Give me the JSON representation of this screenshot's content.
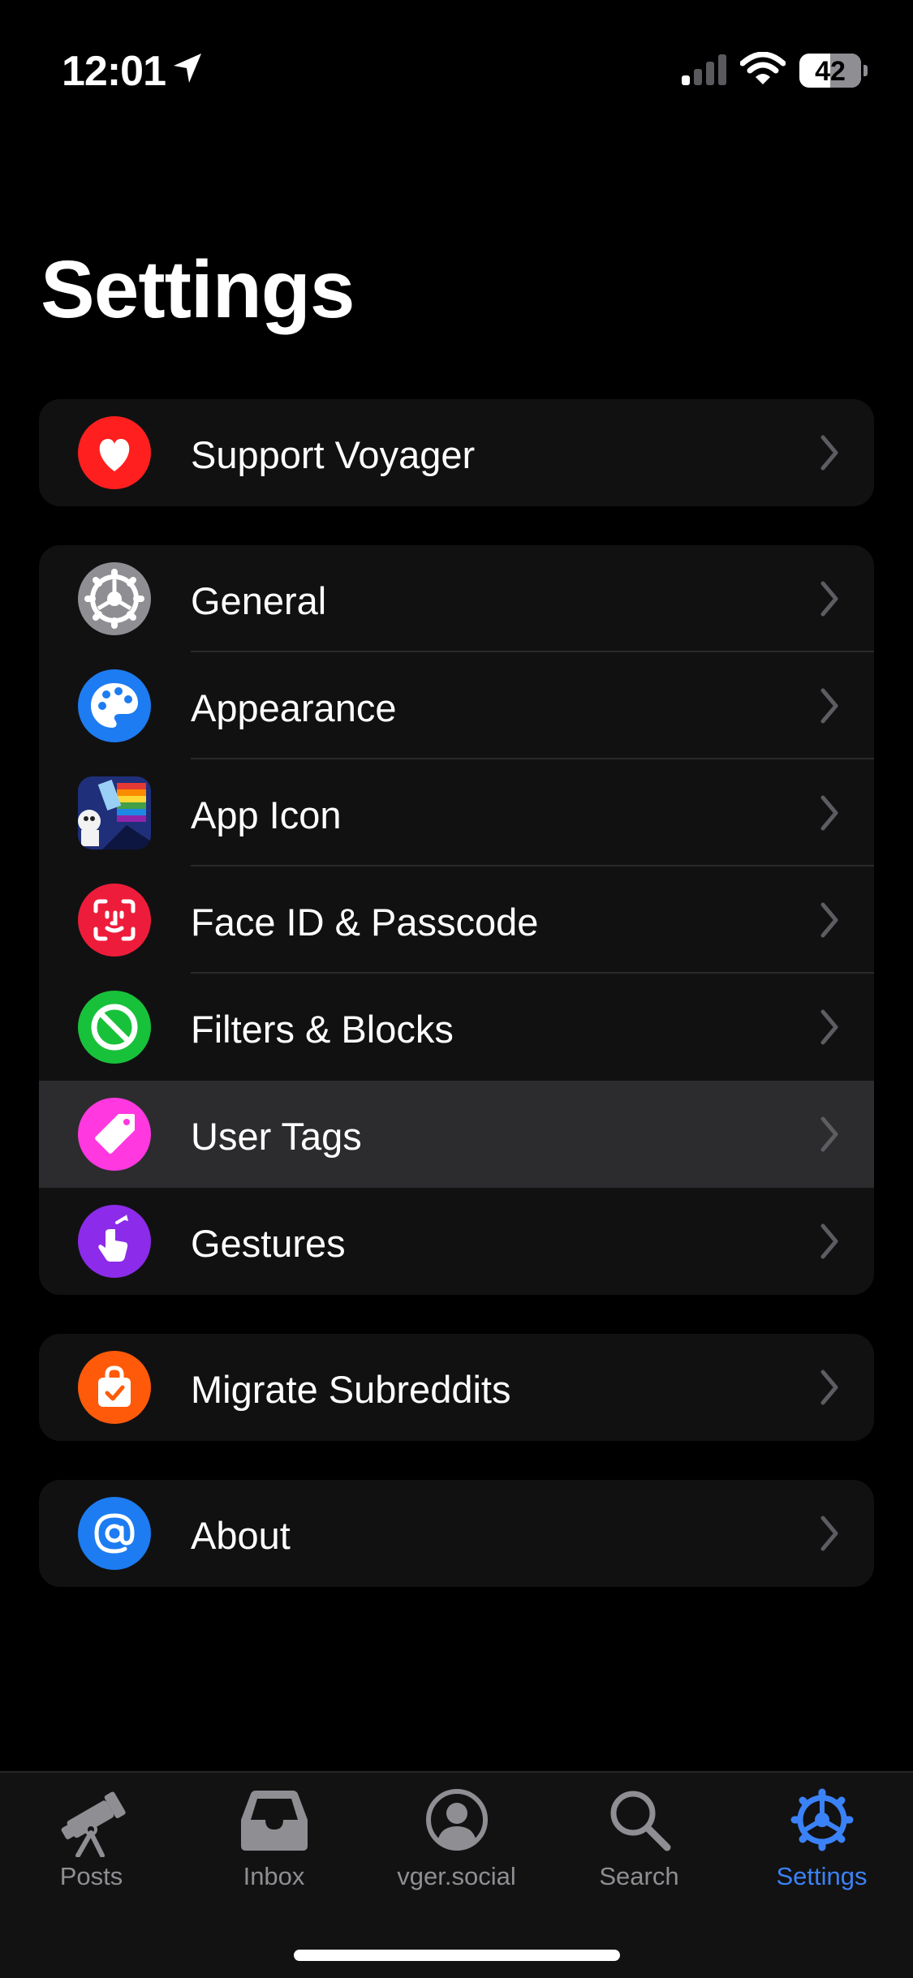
{
  "status_bar": {
    "time": "12:01",
    "battery": "42"
  },
  "page": {
    "title": "Settings"
  },
  "groups": [
    {
      "items": [
        {
          "label": "Support Voyager",
          "icon": "heart-icon",
          "color": "#ff1f1f"
        }
      ]
    },
    {
      "items": [
        {
          "label": "General",
          "icon": "gear-icon",
          "color": "#8e8e93"
        },
        {
          "label": "Appearance",
          "icon": "palette-icon",
          "color": "#1d7cf2"
        },
        {
          "label": "App Icon",
          "icon": "app-icon-image"
        },
        {
          "label": "Face ID & Passcode",
          "icon": "face-id-icon",
          "color": "#ee1c3b"
        },
        {
          "label": "Filters & Blocks",
          "icon": "block-icon",
          "color": "#18c13a"
        },
        {
          "label": "User Tags",
          "icon": "tag-icon",
          "color": "#ff38e0"
        },
        {
          "label": "Gestures",
          "icon": "hand-tap-icon",
          "color": "#8c2bea"
        }
      ]
    },
    {
      "items": [
        {
          "label": "Migrate Subreddits",
          "icon": "shopping-bag-icon",
          "color": "#ff5a0a"
        }
      ]
    },
    {
      "items": [
        {
          "label": "About",
          "icon": "at-sign-icon",
          "color": "#1d7cf2"
        }
      ]
    }
  ],
  "tab_bar": {
    "tabs": [
      {
        "label": "Posts",
        "icon": "telescope-icon"
      },
      {
        "label": "Inbox",
        "icon": "inbox-tray-icon"
      },
      {
        "label": "vger.social",
        "icon": "person-circle-icon"
      },
      {
        "label": "Search",
        "icon": "magnifier-icon"
      },
      {
        "label": "Settings",
        "icon": "gear-icon",
        "active": true
      }
    ],
    "active_color": "#3b82f6",
    "inactive_color": "#8e8e93"
  }
}
